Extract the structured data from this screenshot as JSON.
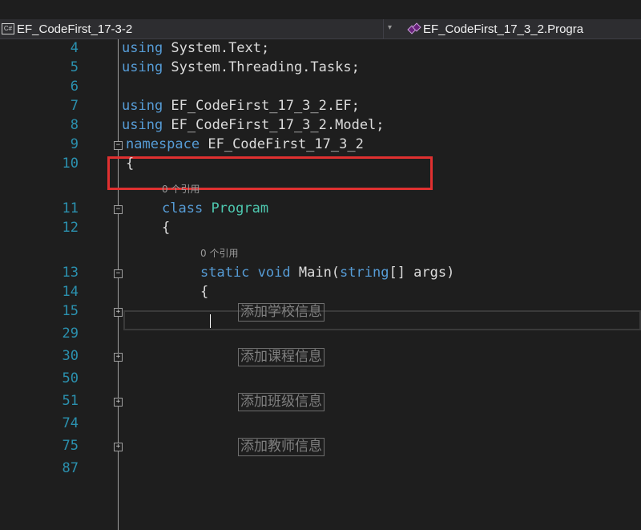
{
  "navbar": {
    "project_icon": "C#",
    "project": "EF_CodeFirst_17-3-2",
    "dropdown_icon": "chevron-down-icon",
    "class_icon": "class-icon",
    "class_path": "EF_CodeFirst_17_3_2.Progra"
  },
  "lines": [
    {
      "num": "4",
      "segments": [
        {
          "t": "using",
          "c": "kw"
        },
        {
          "t": " System.Text;"
        }
      ]
    },
    {
      "num": "5",
      "segments": [
        {
          "t": "using",
          "c": "kw"
        },
        {
          "t": " System.Threading.Tasks;"
        }
      ]
    },
    {
      "num": "6",
      "segments": []
    },
    {
      "num": "7",
      "segments": [
        {
          "t": "using",
          "c": "kw"
        },
        {
          "t": " EF_CodeFirst_17_3_2.EF;"
        }
      ]
    },
    {
      "num": "8",
      "segments": [
        {
          "t": "using",
          "c": "kw"
        },
        {
          "t": " EF_CodeFirst_17_3_2.Model;"
        }
      ]
    },
    {
      "num": "9",
      "segments": [
        {
          "t": "namespace",
          "c": "kw"
        },
        {
          "t": " EF_CodeFirst_17_3_2"
        }
      ]
    },
    {
      "num": "10",
      "segments": [
        {
          "t": "{"
        }
      ]
    },
    {
      "num": "11",
      "lens": "0 个引用",
      "segments": [
        {
          "t": "class",
          "c": "kw"
        },
        {
          "t": " "
        },
        {
          "t": "Program",
          "c": "ty"
        }
      ]
    },
    {
      "num": "12",
      "segments": [
        {
          "t": "{"
        }
      ]
    },
    {
      "num": "13",
      "lens": "0 个引用",
      "segments": [
        {
          "t": "static",
          "c": "kw"
        },
        {
          "t": " "
        },
        {
          "t": "void",
          "c": "kw"
        },
        {
          "t": " Main("
        },
        {
          "t": "string",
          "c": "kw"
        },
        {
          "t": "[] args)"
        }
      ]
    },
    {
      "num": "14",
      "segments": [
        {
          "t": "{"
        }
      ]
    },
    {
      "num": "15",
      "collapsed": "添加学校信息"
    },
    {
      "num": "29"
    },
    {
      "num": "30",
      "collapsed": "添加课程信息"
    },
    {
      "num": "50"
    },
    {
      "num": "51",
      "collapsed": "添加班级信息"
    },
    {
      "num": "74"
    },
    {
      "num": "75",
      "collapsed": "添加教师信息"
    },
    {
      "num": "87"
    }
  ],
  "highlight_label": "namespace highlighted",
  "fold_icons": [
    "collapse-icon",
    "collapse-icon",
    "collapse-icon",
    "expand-icon",
    "expand-icon",
    "expand-icon",
    "expand-icon"
  ]
}
